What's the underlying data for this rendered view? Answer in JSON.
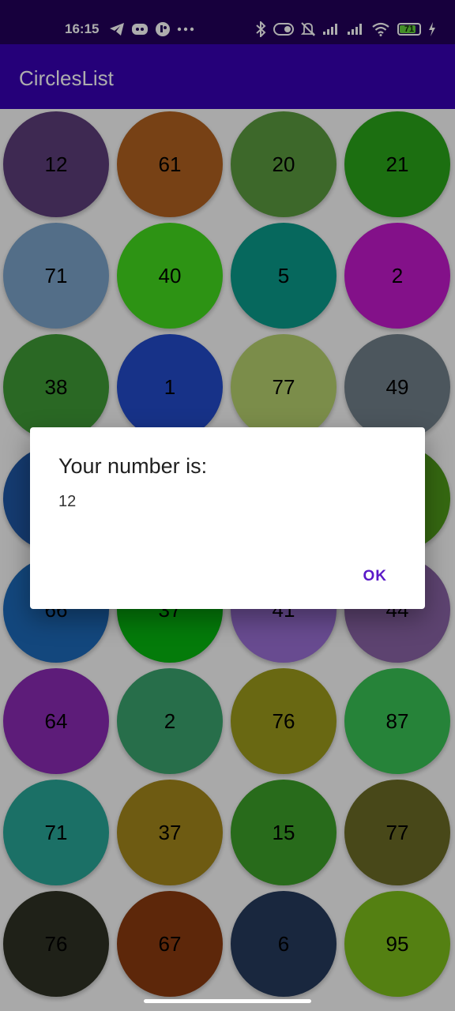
{
  "status_bar": {
    "time": "16:15",
    "left_icons": [
      "telegram-icon",
      "discord-icon",
      "app-icon",
      "more-icon"
    ],
    "right_icons": [
      "bluetooth-icon",
      "toggle-icon",
      "mute-icon",
      "signal-icon",
      "signal-icon",
      "wifi-icon"
    ],
    "battery": "71"
  },
  "app_bar": {
    "title": "CirclesList"
  },
  "grid": {
    "items": [
      {
        "number": "12",
        "color": "#5c3d7a"
      },
      {
        "number": "61",
        "color": "#b0611f"
      },
      {
        "number": "20",
        "color": "#5a9a3f"
      },
      {
        "number": "21",
        "color": "#2aa41a"
      },
      {
        "number": "71",
        "color": "#7ba3c9"
      },
      {
        "number": "40",
        "color": "#43d91e"
      },
      {
        "number": "5",
        "color": "#0a9a8a"
      },
      {
        "number": "2",
        "color": "#c21acb"
      },
      {
        "number": "38",
        "color": "#3f9a36"
      },
      {
        "number": "1",
        "color": "#224bc9"
      },
      {
        "number": "77",
        "color": "#b5d06e"
      },
      {
        "number": "49",
        "color": "#717f89"
      },
      {
        "number": "",
        "color": "#1f58a6"
      },
      {
        "number": "",
        "color": "#2aa41a"
      },
      {
        "number": "",
        "color": "#5a9a3f"
      },
      {
        "number": "",
        "color": "#4f9a1a"
      },
      {
        "number": "66",
        "color": "#1c69b8"
      },
      {
        "number": "37",
        "color": "#06b50f"
      },
      {
        "number": "41",
        "color": "#9a6fd5"
      },
      {
        "number": "44",
        "color": "#8a64a6"
      },
      {
        "number": "64",
        "color": "#8a2ab3"
      },
      {
        "number": "2",
        "color": "#3aa36d"
      },
      {
        "number": "76",
        "color": "#9b9a1b"
      },
      {
        "number": "87",
        "color": "#39c254"
      },
      {
        "number": "71",
        "color": "#28a597"
      },
      {
        "number": "37",
        "color": "#a3861b"
      },
      {
        "number": "15",
        "color": "#3b9e28"
      },
      {
        "number": "77",
        "color": "#6a6a25"
      },
      {
        "number": "76",
        "color": "#2e3124"
      },
      {
        "number": "67",
        "color": "#8a3a0f"
      },
      {
        "number": "6",
        "color": "#263a5c"
      },
      {
        "number": "95",
        "color": "#7dbd1b"
      }
    ]
  },
  "dialog": {
    "title": "Your number is:",
    "message": "12",
    "ok_label": "OK"
  }
}
